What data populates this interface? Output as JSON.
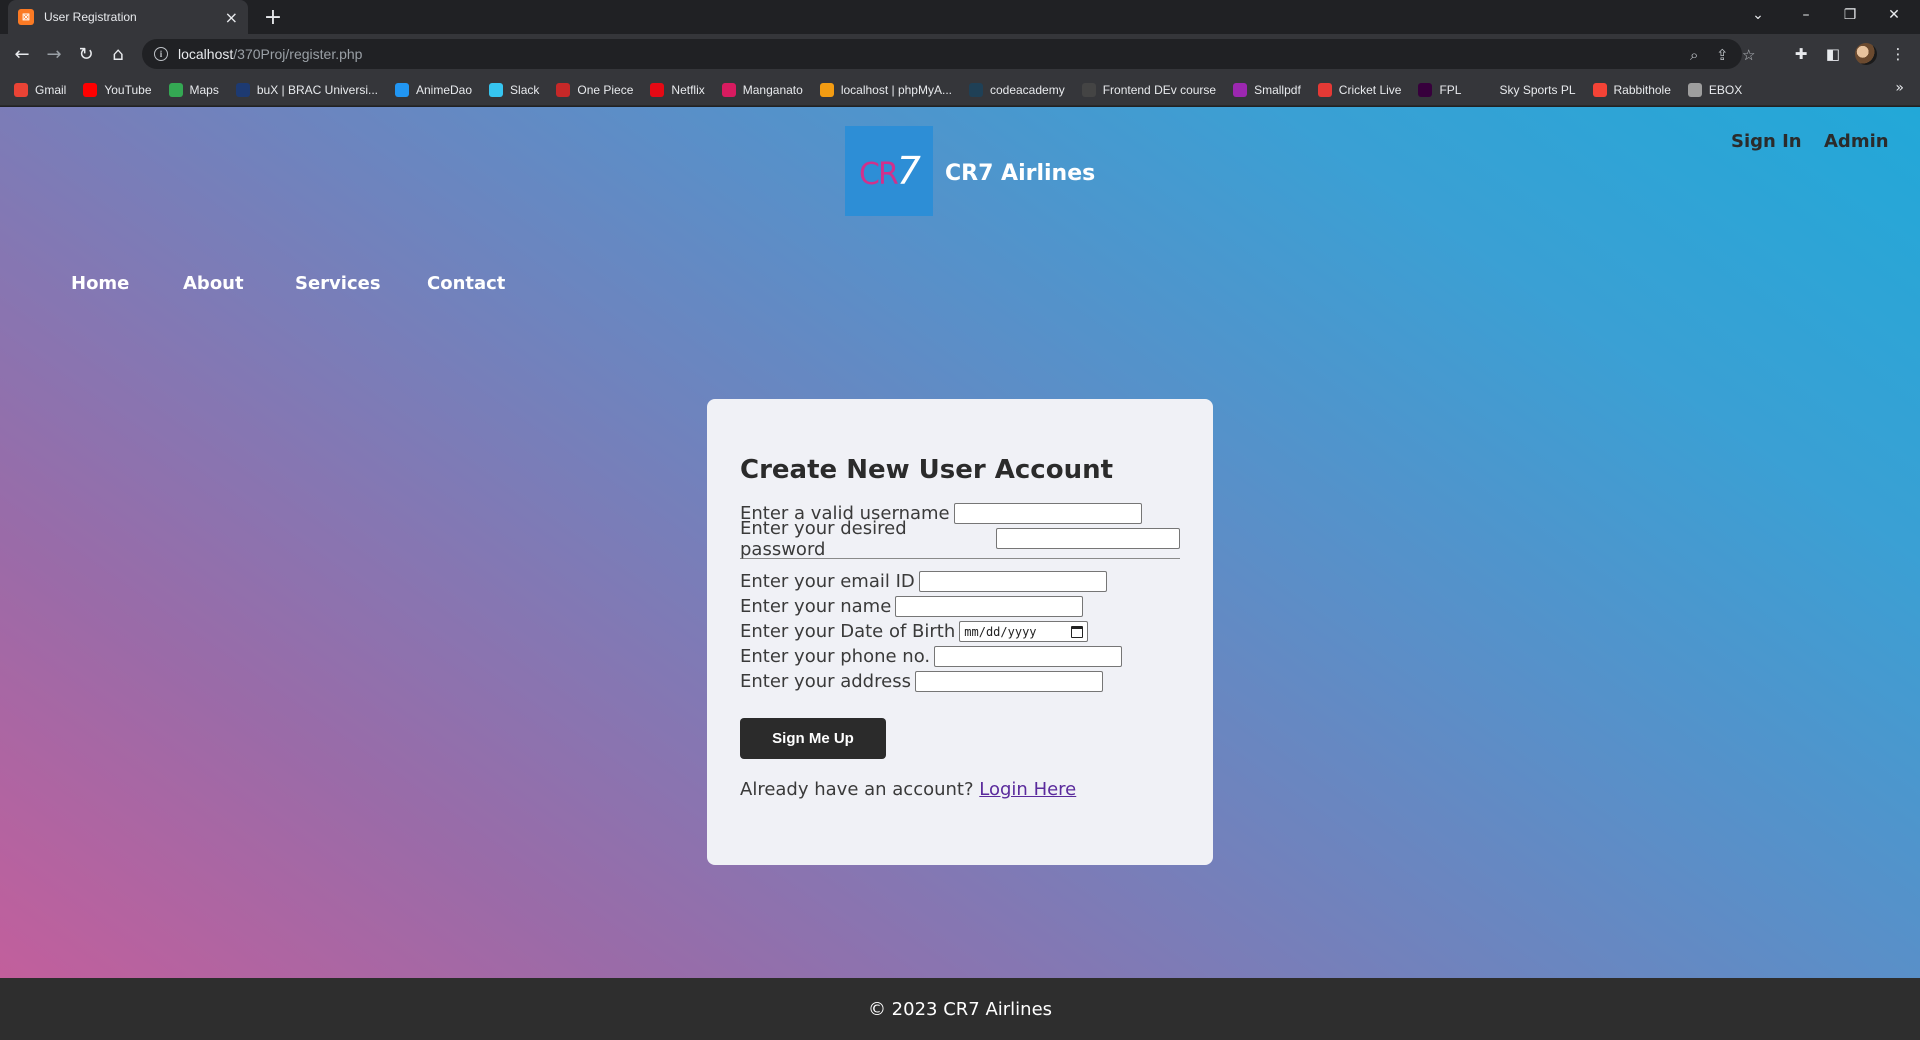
{
  "browser": {
    "tab_title": "User Registration",
    "tab_favicon": "xampp",
    "tab_close": "×",
    "new_tab": "+",
    "url_host": "localhost",
    "url_path": "/370Proj/register.php",
    "window_controls": {
      "minimize": "–",
      "restore": "❐",
      "close": "✕",
      "tab_search": "⌄"
    },
    "bookmarks": [
      {
        "label": "Gmail",
        "color": "#ea4335"
      },
      {
        "label": "YouTube",
        "color": "#ff0000"
      },
      {
        "label": "Maps",
        "color": "#34a853"
      },
      {
        "label": "buX | BRAC Universi...",
        "color": "#1d3a72"
      },
      {
        "label": "AnimeDao",
        "color": "#2196f3"
      },
      {
        "label": "Slack",
        "color": "#36c5f0"
      },
      {
        "label": "One Piece",
        "color": "#c62828"
      },
      {
        "label": "Netflix",
        "color": "#e50914"
      },
      {
        "label": "Manganato",
        "color": "#d81b60"
      },
      {
        "label": "localhost | phpMyA...",
        "color": "#f39c12"
      },
      {
        "label": "codeacademy",
        "color": "#1f4056"
      },
      {
        "label": "Frontend DEv course",
        "color": "#444444"
      },
      {
        "label": "Smallpdf",
        "color": "#9c27b0"
      },
      {
        "label": "Cricket Live",
        "color": "#e53935"
      },
      {
        "label": "FPL",
        "color": "#37003c"
      },
      {
        "label": "Sky Sports PL",
        "color": "#35363a"
      },
      {
        "label": "Rabbithole",
        "color": "#f44336"
      },
      {
        "label": "EBOX",
        "color": "#9e9e9e"
      }
    ],
    "bookmarks_more": "»"
  },
  "site": {
    "logo_text": "CR",
    "logo_seven": "7",
    "brand": "CR7 Airlines",
    "top_links": {
      "sign_in": "Sign In",
      "admin": "Admin"
    },
    "nav": {
      "home": "Home",
      "about": "About",
      "services": "Services",
      "contact": "Contact"
    }
  },
  "form": {
    "title": "Create New User Account",
    "username_label": "Enter a valid username",
    "password_label": "Enter your desired password",
    "email_label": "Enter your email ID",
    "name_label": "Enter your name",
    "dob_label": "Enter your Date of Birth",
    "dob_placeholder": "mm/dd/yyyy",
    "phone_label": "Enter your phone no.",
    "address_label": "Enter your address",
    "submit": "Sign Me Up",
    "already_text": "Already have an account?",
    "login_link": "Login Here"
  },
  "footer": {
    "text": "© 2023 CR7 Airlines"
  }
}
